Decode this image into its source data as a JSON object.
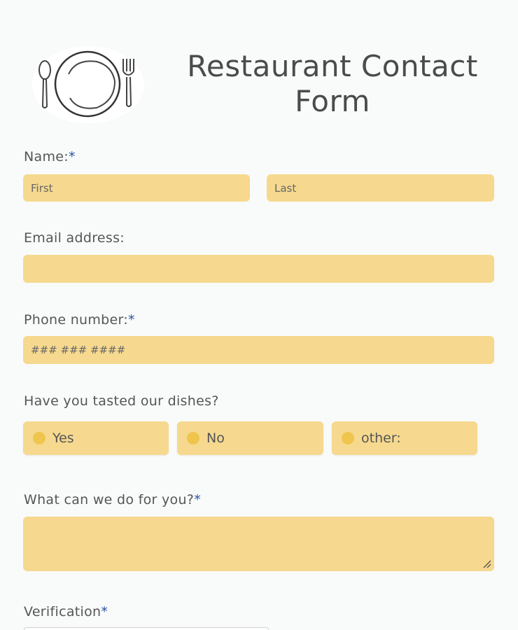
{
  "header": {
    "title": "Restaurant Contact Form"
  },
  "logo": {
    "icon": "plate-fork-spoon-icon"
  },
  "form": {
    "name": {
      "label": "Name:",
      "required_mark": "*",
      "first_placeholder": "First",
      "last_placeholder": "Last"
    },
    "email": {
      "label": "Email address:",
      "placeholder": ""
    },
    "phone": {
      "label": "Phone number:",
      "required_mark": "*",
      "placeholder": "### ### ####"
    },
    "tasted": {
      "label": "Have you tasted our dishes?",
      "options": [
        "Yes",
        "No",
        "other:"
      ]
    },
    "request": {
      "label": "What can we do for you?",
      "required_mark": "*",
      "placeholder": ""
    },
    "verification": {
      "label": "Verification",
      "required_mark": "*"
    }
  },
  "colors": {
    "background": "#f9fbfa",
    "field": "#f6d98f",
    "radio_dot": "#f0c54d",
    "required": "#2b53a6",
    "text": "#4a4a4a"
  }
}
